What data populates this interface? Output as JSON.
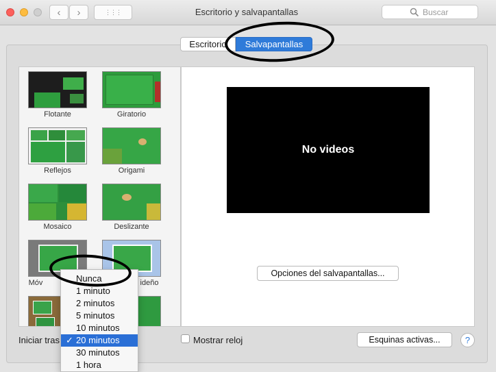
{
  "window": {
    "title": "Escritorio y salvapantallas",
    "search_placeholder": "Buscar",
    "nav_back": "‹",
    "nav_forward": "›",
    "grid_glyph": "⋮⋮⋮"
  },
  "tabs": [
    {
      "label": "Escritorio",
      "active": false
    },
    {
      "label": "Salvapantallas",
      "active": true
    }
  ],
  "savers": [
    {
      "label": "Flotante"
    },
    {
      "label": "Giratorio"
    },
    {
      "label": "Reflejos"
    },
    {
      "label": "Origami"
    },
    {
      "label": "Mosaico"
    },
    {
      "label": "Deslizante"
    },
    {
      "label": "Móv"
    },
    {
      "label": "ideño"
    }
  ],
  "preview": {
    "text": "No videos",
    "options_button": "Opciones del salvapantallas..."
  },
  "bottom": {
    "start_label": "Iniciar tras",
    "show_clock_label": "Mostrar reloj",
    "hot_corners_button": "Esquinas activas...",
    "help": "?"
  },
  "start_menu": {
    "items": [
      "Nunca",
      "1 minuto",
      "2 minutos",
      "5 minutos",
      "10 minutos",
      "20 minutos",
      "30 minutos",
      "1 hora"
    ],
    "selected": "20 minutos",
    "check": "✓"
  },
  "colors": {
    "accent": "#2f7bd9",
    "menu_selection": "#2a6fd6",
    "preview_bg": "#000000"
  }
}
